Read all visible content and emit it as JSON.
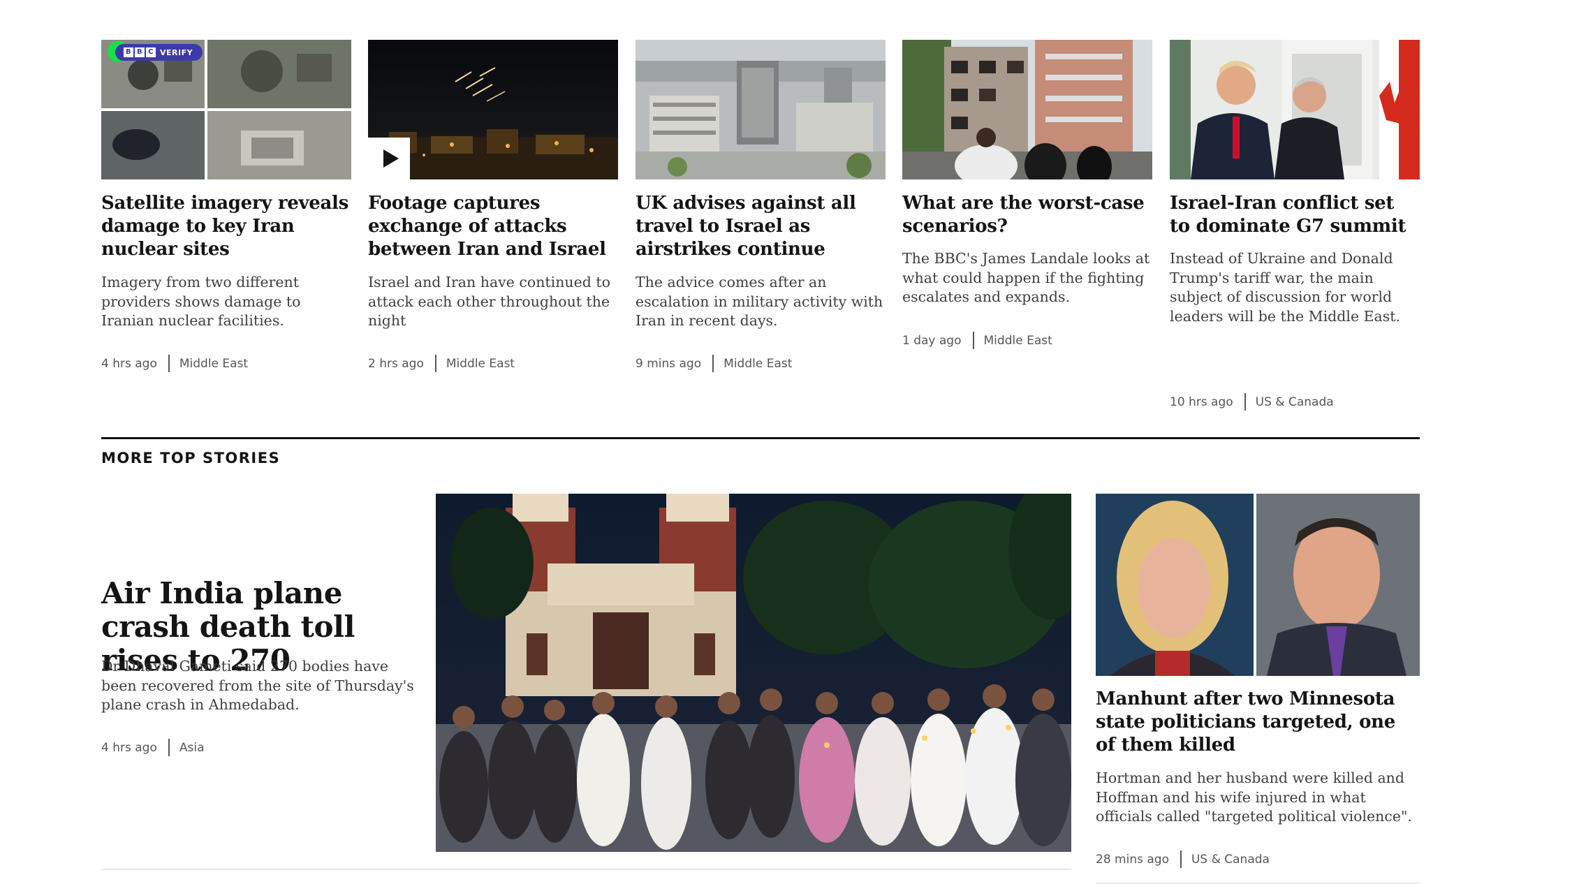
{
  "top_cards": [
    {
      "headline": "Satellite imagery reveals damage to key Iran nuclear sites",
      "summary": "Imagery from two different providers shows damage to Iranian nuclear facilities.",
      "time": "4 hrs ago",
      "category": "Middle East",
      "badge": {
        "bbc": [
          "B",
          "B",
          "C"
        ],
        "label": "VERIFY"
      }
    },
    {
      "headline": "Footage captures exchange of attacks between Iran and Israel",
      "summary": "Israel and Iran have continued to attack each other throughout the night",
      "time": "2 hrs ago",
      "category": "Middle East",
      "media_icon": "play-icon"
    },
    {
      "headline": "UK advises against all travel to Israel as airstrikes continue",
      "summary": "The advice comes after an escalation in military activity with Iran in recent days.",
      "time": "9 mins ago",
      "category": "Middle East"
    },
    {
      "headline": "What are the worst-case scenarios?",
      "summary": "The BBC's James Landale looks at what could happen if the fighting escalates and expands.",
      "time": "1 day ago",
      "category": "Middle East"
    },
    {
      "headline": "Israel-Iran conflict set to dominate G7 summit",
      "summary": "Instead of Ukraine and Donald Trump's tariff war, the main subject of discussion for world leaders will be the Middle East.",
      "time": "10 hrs ago",
      "category": "US & Canada"
    }
  ],
  "section_title": "MORE TOP STORIES",
  "lead_story": {
    "headline": "Air India plane crash death toll rises to 270",
    "summary": "Dr Dhaval Gameti said 270 bodies have been recovered from the site of Thursday's plane crash in Ahmedabad.",
    "time": "4 hrs ago",
    "category": "Asia"
  },
  "side_story": {
    "headline": "Manhunt after two Minnesota state politicians targeted, one of them killed",
    "summary": "Hortman and her husband were killed and Hoffman and his wife injured in what officials called \"targeted political violence\".",
    "time": "28 mins ago",
    "category": "US & Canada"
  },
  "colors": {
    "text": "#141414",
    "summary": "#3f3f42",
    "meta": "#545658",
    "verify_badge": "#3c3aa8",
    "verify_dot": "#16e04a"
  }
}
